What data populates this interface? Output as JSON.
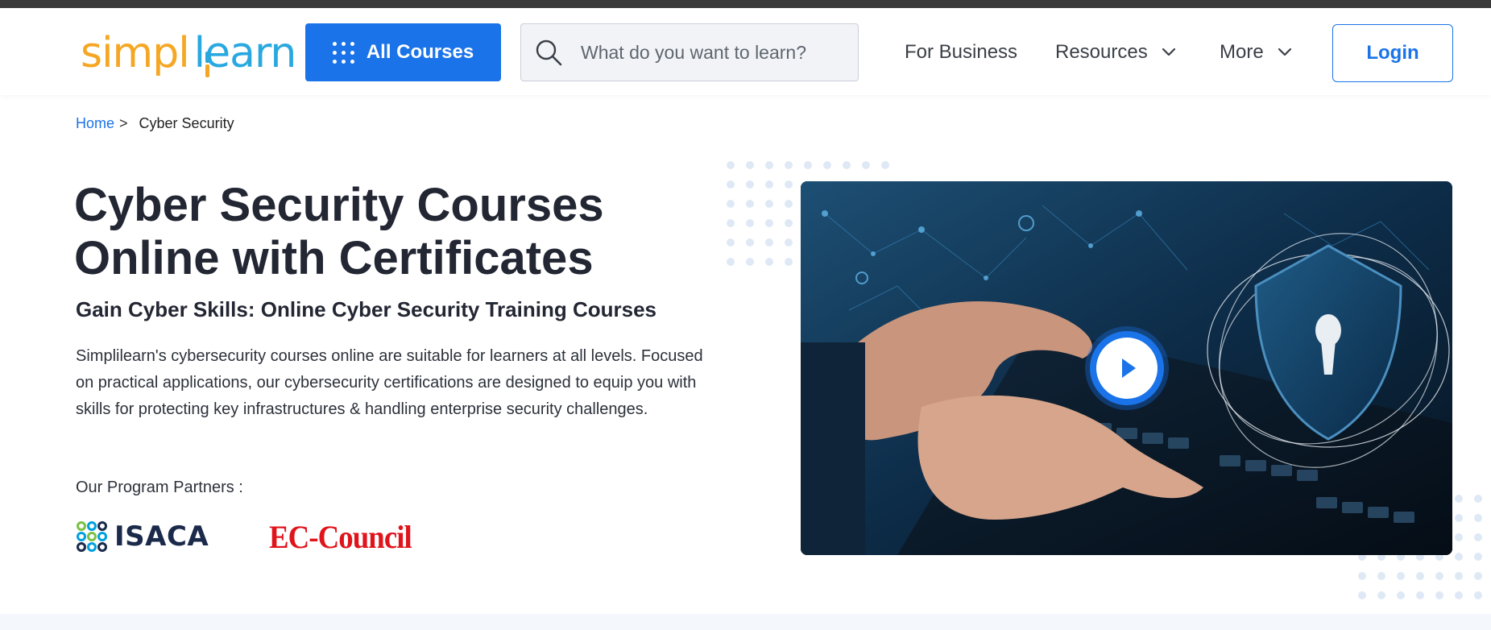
{
  "header": {
    "logo": {
      "part1": "simpl",
      "part2": "learn"
    },
    "all_courses_label": "All Courses",
    "search_placeholder": "What do you want to learn?",
    "nav": [
      {
        "label": "For Business"
      },
      {
        "label": "Resources"
      },
      {
        "label": "More"
      }
    ],
    "login_label": "Login"
  },
  "breadcrumb": {
    "home": "Home",
    "separator": ">",
    "current": "Cyber Security"
  },
  "hero": {
    "title": "Cyber Security Courses Online with Certificates",
    "subtitle": "Gain Cyber Skills: Online Cyber Security Training Courses",
    "description": "Simplilearn's cybersecurity courses online are suitable for learners at all levels. Focused on practical applications, our cybersecurity certifications are designed to equip you with skills for protecting key infrastructures & handling enterprise security challenges.",
    "partners_label": "Our Program Partners :",
    "partners": [
      {
        "name": "ISACA"
      },
      {
        "name": "EC-Council"
      }
    ]
  },
  "colors": {
    "primary": "#1a73e8",
    "logo_orange": "#f5a623",
    "logo_blue": "#29a8e0",
    "ec_red": "#e0141b",
    "heading": "#232733"
  }
}
